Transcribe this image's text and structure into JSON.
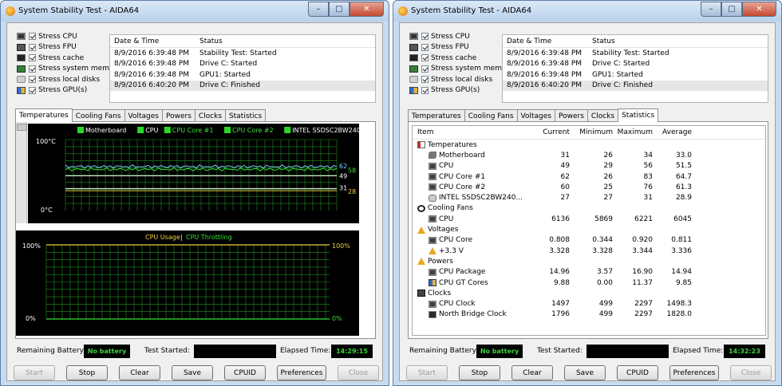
{
  "window_title": "System Stability Test - AIDA64",
  "stress_items": [
    {
      "label": "Stress CPU",
      "icon": "cpu-icon"
    },
    {
      "label": "Stress FPU",
      "icon": "fpu-icon"
    },
    {
      "label": "Stress cache",
      "icon": "cache-icon"
    },
    {
      "label": "Stress system memory",
      "icon": "memory-icon"
    },
    {
      "label": "Stress local disks",
      "icon": "disk-icon"
    },
    {
      "label": "Stress GPU(s)",
      "icon": "gpu-icon"
    }
  ],
  "log": {
    "headers": [
      "Date & Time",
      "Status"
    ],
    "rows": [
      [
        "8/9/2016 6:39:48 PM",
        "Stability Test: Started"
      ],
      [
        "8/9/2016 6:39:48 PM",
        "Drive C: Started"
      ],
      [
        "8/9/2016 6:39:48 PM",
        "GPU1: Started"
      ],
      [
        "8/9/2016 6:40:20 PM",
        "Drive C: Finished"
      ]
    ]
  },
  "tabs": [
    "Temperatures",
    "Cooling Fans",
    "Voltages",
    "Powers",
    "Clocks",
    "Statistics"
  ],
  "temp_graph": {
    "legend": [
      "Motherboard",
      "CPU",
      "CPU Core #1",
      "CPU Core #2",
      "INTEL SSDSC2BW240A4"
    ],
    "y_top": "100°C",
    "y_bottom": "0°C",
    "end_labels": [
      "62",
      "58",
      "49",
      "31",
      "28"
    ],
    "series": [
      {
        "value": 62,
        "color": "#7fc8ff"
      },
      {
        "value": 58,
        "color": "#33e033"
      },
      {
        "value": 49,
        "color": "#ffffff"
      },
      {
        "value": 31,
        "color": "#ffffff"
      },
      {
        "value": 28,
        "color": "#f0d040"
      }
    ]
  },
  "cpu_graph": {
    "title_usage": "CPU Usage",
    "title_sep": "|",
    "title_throttle": "CPU Throttling",
    "left_top": "100%",
    "left_bottom": "0%",
    "right_top": "100%",
    "right_bottom": "0%",
    "usage_value": 100,
    "throttle_value": 0
  },
  "colors": {
    "graph_green": "#33e033",
    "graph_yellow": "#f0d040",
    "grid": "#1f8f1f"
  },
  "statistics": {
    "headers": [
      "Item",
      "Current",
      "Minimum",
      "Maximum",
      "Average"
    ],
    "rows": [
      {
        "level": 0,
        "icon": "ic-thermo",
        "name": "Temperatures",
        "values": [
          "",
          "",
          "",
          ""
        ]
      },
      {
        "level": 1,
        "icon": "ic-mobo",
        "name": "Motherboard",
        "values": [
          "31",
          "26",
          "34",
          "33.0"
        ]
      },
      {
        "level": 1,
        "icon": "ic-chip",
        "name": "CPU",
        "values": [
          "49",
          "29",
          "56",
          "51.5"
        ]
      },
      {
        "level": 1,
        "icon": "ic-chip",
        "name": "CPU Core #1",
        "values": [
          "62",
          "26",
          "83",
          "64.7"
        ]
      },
      {
        "level": 1,
        "icon": "ic-chip",
        "name": "CPU Core #2",
        "values": [
          "60",
          "25",
          "76",
          "61.3"
        ]
      },
      {
        "level": 1,
        "icon": "ic-disk",
        "name": "INTEL SSDSC2BW240...",
        "values": [
          "27",
          "27",
          "31",
          "28.9"
        ]
      },
      {
        "level": 0,
        "icon": "ic-fan",
        "name": "Cooling Fans",
        "values": [
          "",
          "",
          "",
          ""
        ]
      },
      {
        "level": 1,
        "icon": "ic-chip",
        "name": "CPU",
        "values": [
          "6136",
          "5869",
          "6221",
          "6045"
        ]
      },
      {
        "level": 0,
        "icon": "ic-warn",
        "name": "Voltages",
        "values": [
          "",
          "",
          "",
          ""
        ]
      },
      {
        "level": 1,
        "icon": "ic-chip",
        "name": "CPU Core",
        "values": [
          "0.808",
          "0.344",
          "0.920",
          "0.811"
        ]
      },
      {
        "level": 1,
        "icon": "ic-warnsm",
        "name": "+3.3 V",
        "values": [
          "3.328",
          "3.328",
          "3.344",
          "3.336"
        ]
      },
      {
        "level": 0,
        "icon": "ic-warn",
        "name": "Powers",
        "values": [
          "",
          "",
          "",
          ""
        ]
      },
      {
        "level": 1,
        "icon": "ic-chip",
        "name": "CPU Package",
        "values": [
          "14.96",
          "3.57",
          "16.90",
          "14.94"
        ]
      },
      {
        "level": 1,
        "icon": "ic-gpu",
        "name": "CPU GT Cores",
        "values": [
          "9.88",
          "0.00",
          "11.37",
          "9.85"
        ]
      },
      {
        "level": 0,
        "icon": "ic-clock",
        "name": "Clocks",
        "values": [
          "",
          "",
          "",
          ""
        ]
      },
      {
        "level": 1,
        "icon": "ic-chip",
        "name": "CPU Clock",
        "values": [
          "1497",
          "499",
          "2297",
          "1498.3"
        ]
      },
      {
        "level": 1,
        "icon": "ic-nb",
        "name": "North Bridge Clock",
        "values": [
          "1796",
          "499",
          "2297",
          "1828.0"
        ]
      }
    ]
  },
  "bottom": {
    "battery_label": "Remaining Battery:",
    "battery_value": "No battery",
    "started_label": "Test Started:",
    "started_value": "",
    "elapsed_label": "Elapsed Time:",
    "elapsed_left": "14:29:15",
    "elapsed_right": "14:32:23"
  },
  "buttons": [
    {
      "label": "Start",
      "enabled": false
    },
    {
      "label": "Stop",
      "enabled": true
    },
    {
      "label": "Clear",
      "enabled": true
    },
    {
      "label": "Save",
      "enabled": true
    },
    {
      "label": "CPUID",
      "enabled": true
    },
    {
      "label": "Preferences",
      "enabled": true
    },
    {
      "label": "Close",
      "enabled": false
    }
  ]
}
